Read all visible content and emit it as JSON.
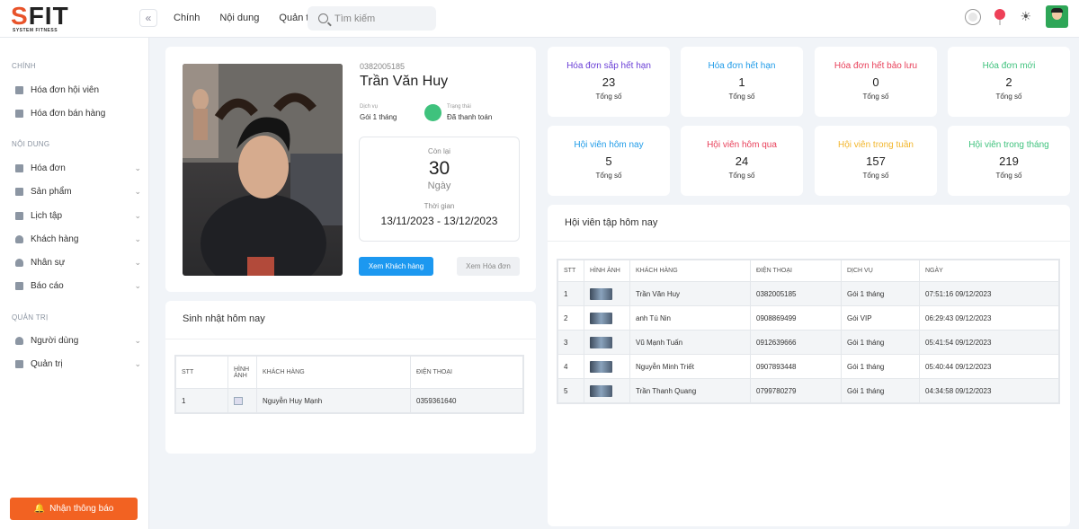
{
  "brand": {
    "logo": "SFIT",
    "tagline": "SYSTEM FITNESS"
  },
  "nav": {
    "items": [
      "Chính",
      "Nội dung",
      "Quản trị"
    ],
    "search_placeholder": "Tìm kiếm"
  },
  "sidebar": {
    "sections": [
      {
        "title": "CHÍNH",
        "items": [
          "Hóa đơn hội viên",
          "Hóa đơn bán hàng"
        ]
      },
      {
        "title": "NỘI DUNG",
        "items": [
          "Hóa đơn",
          "Sản phẩm",
          "Lịch tập",
          "Khách hàng",
          "Nhân sự",
          "Báo cáo"
        ]
      },
      {
        "title": "QUẢN TRỊ",
        "items": [
          "Người dùng",
          "Quản trị"
        ]
      }
    ],
    "notify_label": "Nhận thông báo"
  },
  "profile": {
    "phone": "0382005185",
    "name": "Trần Văn Huy",
    "service_label": "Dịch vụ",
    "service": "Gói 1 tháng",
    "status_label": "Trạng thái",
    "status": "Đã thanh toán",
    "status_color": "#3fc27d",
    "remaining_label": "Còn lại",
    "remaining": "30",
    "remaining_unit": "Ngày",
    "period_label": "Thời gian",
    "period": "13/11/2023 - 13/12/2023",
    "btn_customer": "Xem Khách hàng",
    "btn_invoice": "Xem Hóa đơn"
  },
  "birthday": {
    "title": "Sinh nhật hôm nay",
    "headers": [
      "STT",
      "HÌNH ẢNH",
      "KHÁCH HÀNG",
      "ĐIỆN THOẠI"
    ],
    "rows": [
      [
        "1",
        "",
        "Nguyễn Huy Mạnh",
        "0359361640"
      ]
    ]
  },
  "stats": [
    {
      "title": "Hóa đơn sắp hết hạn",
      "value": "23",
      "sub": "Tổng số",
      "color": "#6a3fd6"
    },
    {
      "title": "Hóa đơn hết hạn",
      "value": "1",
      "sub": "Tổng số",
      "color": "#1f9be8"
    },
    {
      "title": "Hóa đơn hết bảo lưu",
      "value": "0",
      "sub": "Tổng số",
      "color": "#e8405a"
    },
    {
      "title": "Hóa đơn mới",
      "value": "2",
      "sub": "Tổng số",
      "color": "#3fc27d"
    },
    {
      "title": "Hội viên hôm nay",
      "value": "5",
      "sub": "Tổng số",
      "color": "#1f9be8"
    },
    {
      "title": "Hội viên hôm qua",
      "value": "24",
      "sub": "Tổng số",
      "color": "#e8405a"
    },
    {
      "title": "Hội viên trong tuần",
      "value": "157",
      "sub": "Tổng số",
      "color": "#f2b52a"
    },
    {
      "title": "Hội viên trong tháng",
      "value": "219",
      "sub": "Tổng số",
      "color": "#3fc27d"
    }
  ],
  "today": {
    "title": "Hội viên tập hôm nay",
    "headers": [
      "STT",
      "HÌNH ẢNH",
      "KHÁCH HÀNG",
      "ĐIỆN THOẠI",
      "DỊCH VỤ",
      "NGÀY"
    ],
    "rows": [
      [
        "1",
        "",
        "Trần Văn Huy",
        "0382005185",
        "Gói 1 tháng",
        "07:51:16 09/12/2023"
      ],
      [
        "2",
        "",
        "anh Tú Nin",
        "0908869499",
        "Gói VIP",
        "06:29:43 09/12/2023"
      ],
      [
        "3",
        "",
        "Vũ Mạnh Tuấn",
        "0912639666",
        "Gói 1 tháng",
        "05:41:54 09/12/2023"
      ],
      [
        "4",
        "",
        "Nguyễn Minh Triết",
        "0907893448",
        "Gói 1 tháng",
        "05:40:44 09/12/2023"
      ],
      [
        "5",
        "",
        "Trần Thanh Quang",
        "0799780279",
        "Gói 1 tháng",
        "04:34:58 09/12/2023"
      ]
    ]
  }
}
